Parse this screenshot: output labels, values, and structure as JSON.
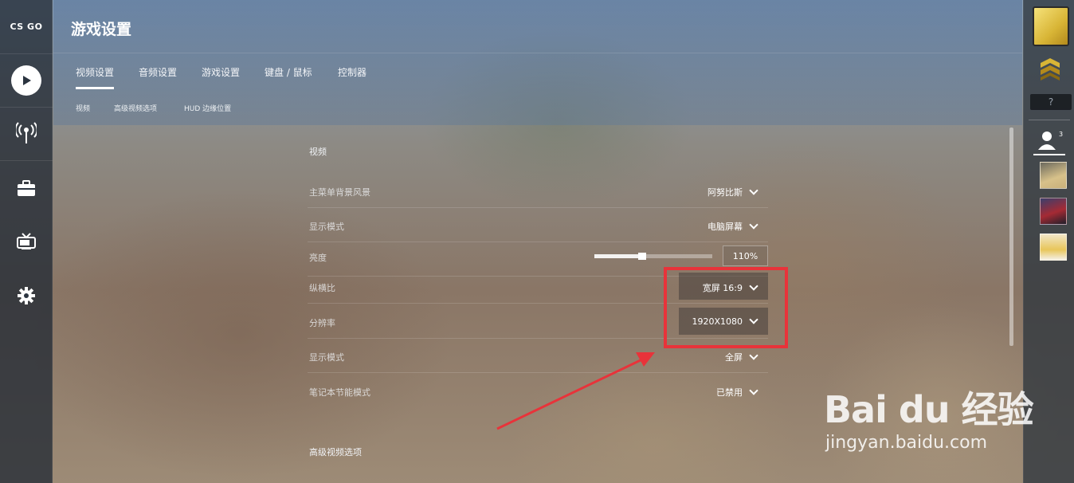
{
  "app": {
    "logo_text": "CS GO"
  },
  "header": {
    "title": "游戏设置",
    "tabs": [
      {
        "label": "视频设置",
        "active": true
      },
      {
        "label": "音频设置",
        "active": false
      },
      {
        "label": "游戏设置",
        "active": false
      },
      {
        "label": "键盘 / 鼠标",
        "active": false
      },
      {
        "label": "控制器",
        "active": false
      }
    ],
    "subtabs": [
      {
        "label": "视频"
      },
      {
        "label": "高级视频选项"
      },
      {
        "label": "HUD 边缘位置"
      }
    ]
  },
  "sidebar": {
    "items": [
      {
        "icon": "play-icon"
      },
      {
        "icon": "broadcast-icon"
      },
      {
        "icon": "inventory-icon"
      },
      {
        "icon": "tv-icon"
      },
      {
        "icon": "gear-icon"
      }
    ]
  },
  "settings": {
    "section_video": "视频",
    "rows": [
      {
        "label": "主菜单背景风景",
        "value": "阿努比斯"
      },
      {
        "label": "显示模式",
        "value": "电脑屏幕"
      },
      {
        "label": "亮度",
        "value": "110%",
        "slider_fraction": 0.4
      },
      {
        "label": "纵横比",
        "value": "宽屏 16:9"
      },
      {
        "label": "分辨率",
        "value": "1920X1080"
      },
      {
        "label": "显示模式",
        "value": "全屏"
      },
      {
        "label": "笔记本节能模式",
        "value": "已禁用"
      }
    ],
    "section_advanced": "高级视频选项"
  },
  "rightbar": {
    "unknown_rank": "?",
    "friends_count": "3"
  },
  "annotation": {
    "color": "#e8333a"
  },
  "watermark": {
    "logo": "Bai du 经验",
    "url": "jingyan.baidu.com"
  }
}
